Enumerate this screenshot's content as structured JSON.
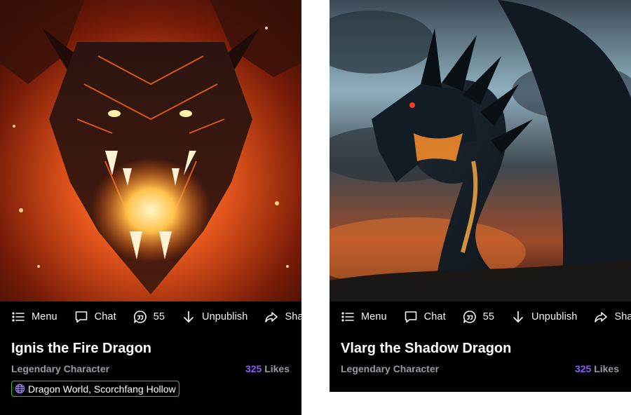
{
  "cards": [
    {
      "toolbar": {
        "menu": "Menu",
        "chat": "Chat",
        "comments": "55",
        "unpublish": "Unpublish",
        "share": "Share"
      },
      "title": "Ignis the Fire Dragon",
      "subtitle": "Legendary Character",
      "likes_count": "325",
      "likes_label": "Likes",
      "tag": "Dragon World, Scorchfang Hollow"
    },
    {
      "toolbar": {
        "menu": "Menu",
        "chat": "Chat",
        "comments": "55",
        "unpublish": "Unpublish",
        "share": "Share"
      },
      "title": "Vlarg the Shadow Dragon",
      "subtitle": "Legendary Character",
      "likes_count": "325",
      "likes_label": "Likes"
    }
  ],
  "colors": {
    "card_bg": "#000000",
    "accent_purple": "#8b5cf6",
    "tag_border_green": "#2fb84e",
    "muted_text": "#9a9aa2"
  },
  "icons": [
    "list-menu-icon",
    "chat-bubble-icon",
    "comment-quote-icon",
    "arrow-down-icon",
    "share-arrow-icon",
    "globe-icon"
  ]
}
